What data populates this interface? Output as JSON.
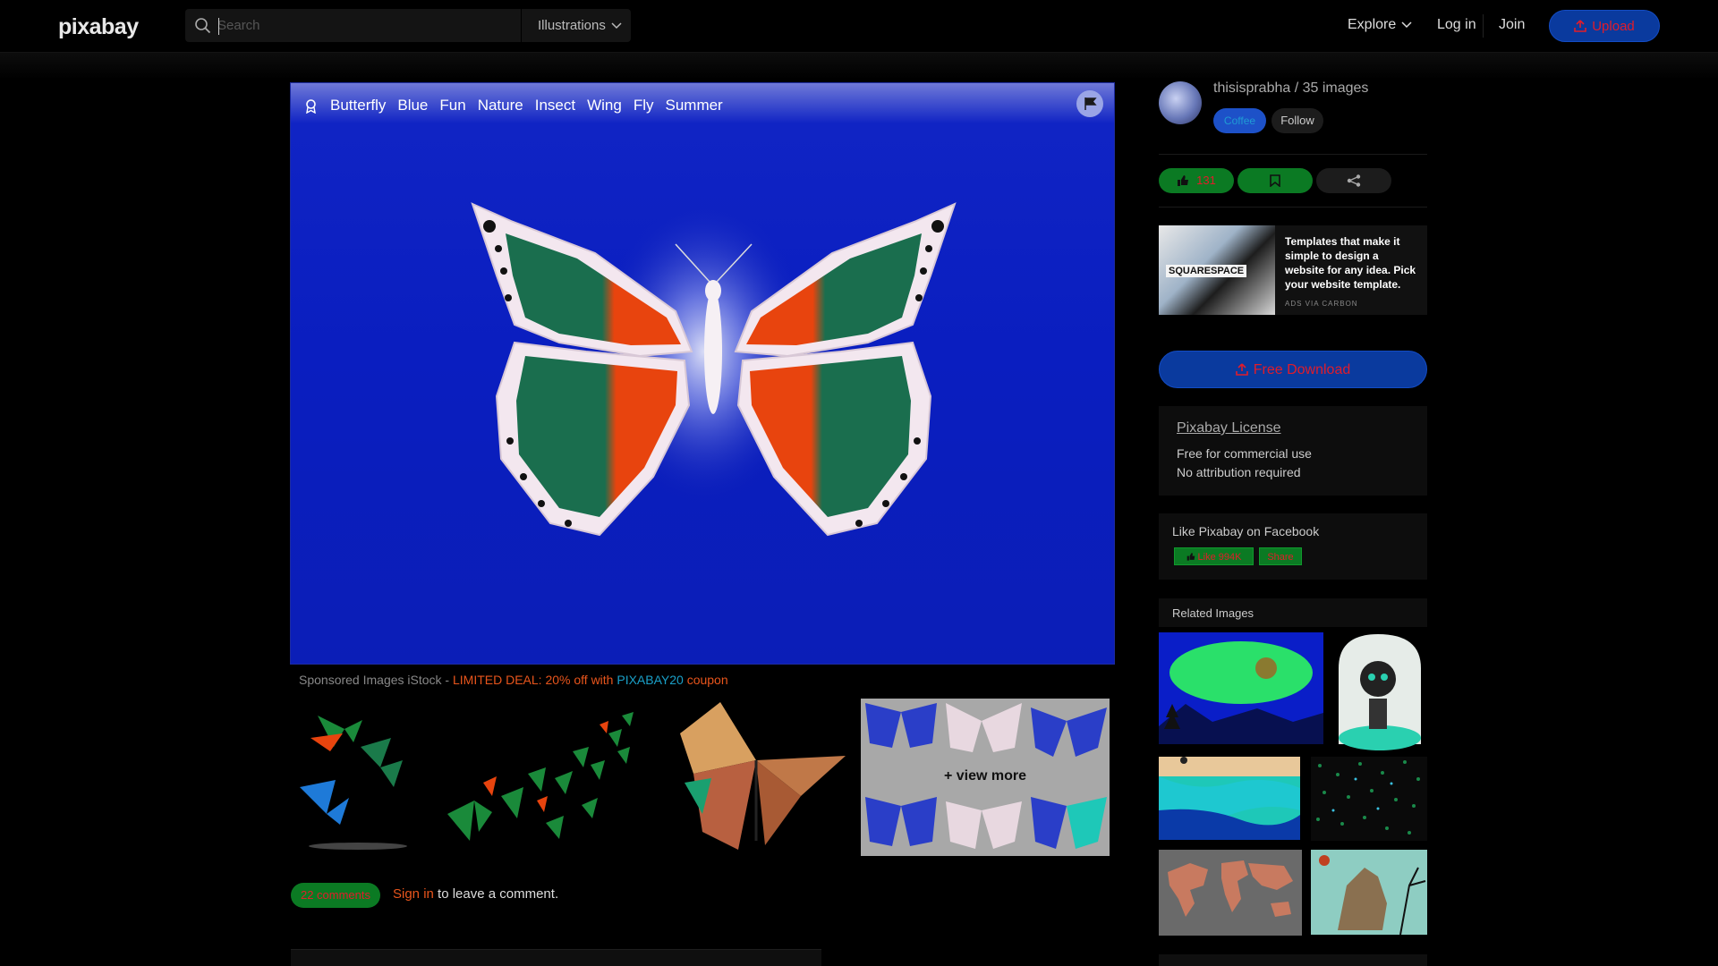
{
  "header": {
    "logo": "pixabay",
    "search_placeholder": "Search",
    "search_scope": "Illustrations",
    "nav_explore": "Explore",
    "nav_login": "Log in",
    "nav_join": "Join",
    "upload_label": "Upload"
  },
  "image": {
    "tags": [
      "Butterfly",
      "Blue",
      "Fun",
      "Nature",
      "Insect",
      "Wing",
      "Fly",
      "Summer"
    ],
    "background_color": "#0b1eb7"
  },
  "sponsored": {
    "prefix": "Sponsored Images iStock - ",
    "deal": "LIMITED DEAL: 20% off with ",
    "code": "PIXABAY20",
    "suffix": " coupon",
    "view_more": "+ view more"
  },
  "comments": {
    "count_label": "22 comments",
    "signin_link": "Sign in",
    "signin_rest": " to leave a comment."
  },
  "author": {
    "name_line": "thisisprabha / 35 images",
    "coffee_label": "Coffee",
    "follow_label": "Follow"
  },
  "actions": {
    "like_count": "131"
  },
  "ad": {
    "brand": "SQUARESPACE",
    "text": "Templates that make it simple to design a website for any idea. Pick your website template.",
    "via": "ADS VIA CARBON"
  },
  "download": {
    "label": "Free Download"
  },
  "license": {
    "title": "Pixabay License",
    "line1": "Free for commercial use",
    "line2": "No attribution required"
  },
  "facebook": {
    "title": "Like Pixabay on Facebook",
    "like_label": "Like 994K",
    "share_label": "Share"
  },
  "related": {
    "title": "Related Images"
  },
  "colors": {
    "accent_green": "#0b7a23",
    "accent_blue": "#0a3a9e",
    "accent_orange": "#e8551c"
  }
}
